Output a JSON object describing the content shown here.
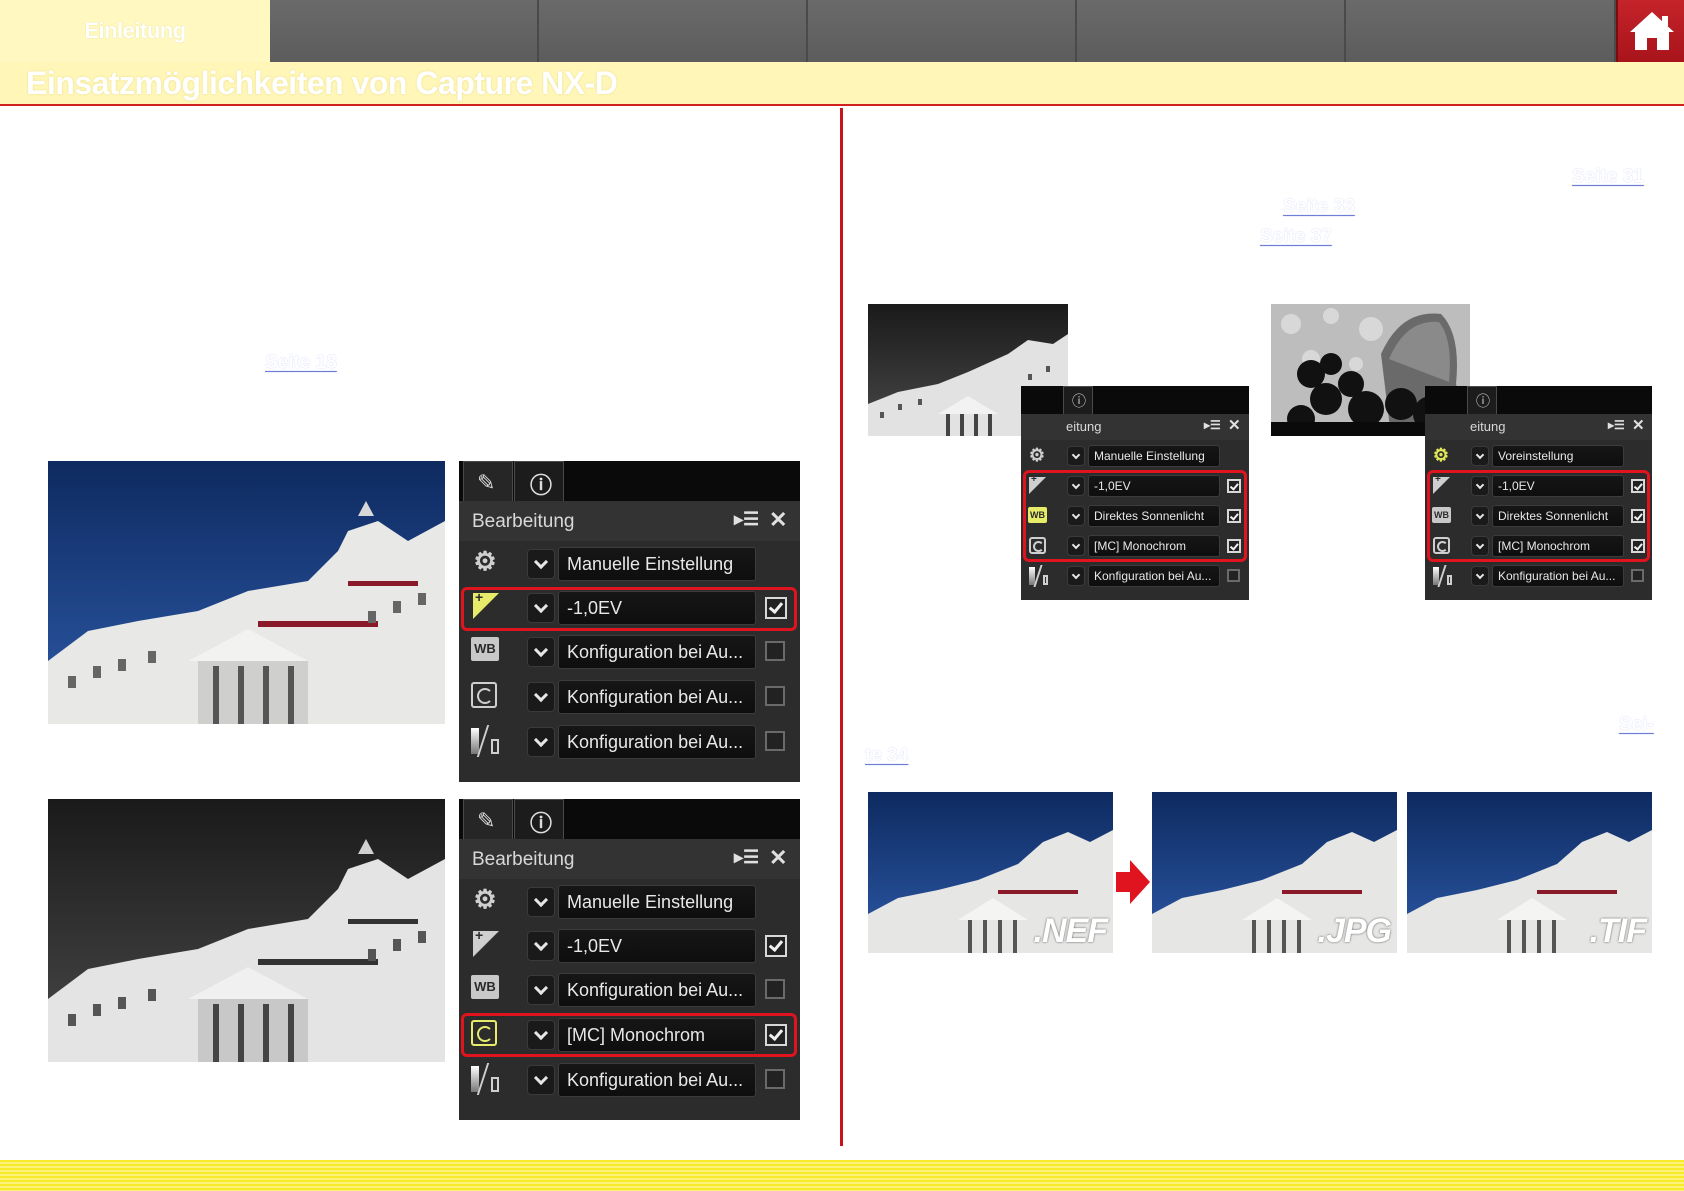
{
  "nav": {
    "tabs": [
      {
        "label": "Einleitung",
        "active": true
      },
      {
        "label": "",
        "active": false
      },
      {
        "label": "",
        "active": false
      },
      {
        "label": "",
        "active": false
      },
      {
        "label": "",
        "active": false
      },
      {
        "label": "",
        "active": false
      }
    ],
    "home_icon": "home-icon",
    "colors": {
      "bar": "#5a5a5a",
      "active_tab": "#fff8c0",
      "home": "#b81c22",
      "accent_red": "#d02020"
    }
  },
  "page_title": "Einsatzmöglichkeiten von Capture NX-D",
  "links": {
    "left_col": "Seite 18",
    "right_col_1": "Seite 31",
    "right_col_2": "Seite 33",
    "right_col_3": "Seite 37",
    "right_col_4_part1": "Sei-",
    "right_col_4_part2": "te 34"
  },
  "panels": {
    "title": "Bearbeitung",
    "title_cut": "eitung",
    "close_icon": "close-icon",
    "menu_icon": "panel-menu-icon",
    "panel1": {
      "rows": [
        {
          "icon": "gear-icon",
          "value": "Manuelle Einstellung",
          "checkbox": null
        },
        {
          "icon": "exposure-icon",
          "value": "-1,0EV",
          "checkbox": true
        },
        {
          "icon": "white-balance-icon",
          "value": "Konfiguration bei Au...",
          "checkbox": false
        },
        {
          "icon": "picture-control-icon",
          "value": "Konfiguration bei Au...",
          "checkbox": false
        },
        {
          "icon": "active-d-lighting-icon",
          "value": "Konfiguration bei Au...",
          "checkbox": false
        }
      ]
    },
    "panel2": {
      "rows": [
        {
          "icon": "gear-icon",
          "value": "Manuelle Einstellung",
          "checkbox": null
        },
        {
          "icon": "exposure-icon",
          "value": "-1,0EV",
          "checkbox": true
        },
        {
          "icon": "white-balance-icon",
          "value": "Konfiguration bei Au...",
          "checkbox": false
        },
        {
          "icon": "picture-control-icon",
          "value": "[MC] Monochrom",
          "checkbox": true
        },
        {
          "icon": "active-d-lighting-icon",
          "value": "Konfiguration bei Au...",
          "checkbox": false
        }
      ]
    },
    "panel3": {
      "rows": [
        {
          "icon": "gear-icon",
          "value": "Manuelle Einstellung",
          "checkbox": null
        },
        {
          "icon": "exposure-icon",
          "value": "-1,0EV",
          "checkbox": true
        },
        {
          "icon": "white-balance-icon",
          "value": "Direktes Sonnenlicht",
          "checkbox": true
        },
        {
          "icon": "picture-control-icon",
          "value": "[MC] Monochrom",
          "checkbox": true
        },
        {
          "icon": "active-d-lighting-icon",
          "value": "Konfiguration bei Au...",
          "checkbox": false
        }
      ]
    },
    "panel4": {
      "rows": [
        {
          "icon": "gear-icon",
          "value": "Voreinstellung",
          "checkbox": null
        },
        {
          "icon": "exposure-icon",
          "value": "-1,0EV",
          "checkbox": true
        },
        {
          "icon": "white-balance-icon",
          "value": "Direktes Sonnenlicht",
          "checkbox": true
        },
        {
          "icon": "picture-control-icon",
          "value": "[MC] Monochrom",
          "checkbox": true
        },
        {
          "icon": "active-d-lighting-icon",
          "value": "Konfiguration bei Au...",
          "checkbox": false
        }
      ]
    }
  },
  "formats": {
    "nef": ".NEF",
    "jpg": ".JPG",
    "tif": ".TIF"
  },
  "footer_color": "#f7ea2a"
}
